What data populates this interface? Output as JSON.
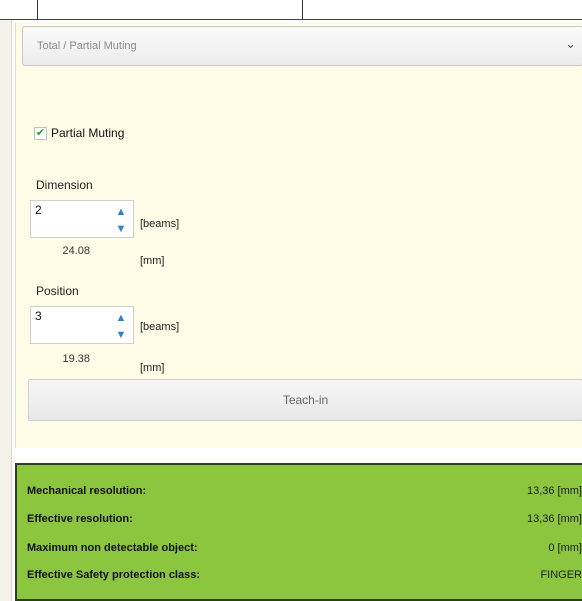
{
  "muting": {
    "dropdown_label": "Total / Partial Muting",
    "partial_muting_label": "Partial Muting",
    "partial_muting_checked": true
  },
  "dimension": {
    "title": "Dimension",
    "value": "2",
    "unit_beams": "[beams]",
    "mm_value": "24.08",
    "unit_mm": "[mm]"
  },
  "position": {
    "title": "Position",
    "value": "3",
    "unit_beams": "[beams]",
    "mm_value": "19.38",
    "unit_mm": "[mm]"
  },
  "teach_in_label": "Teach-in",
  "results": [
    {
      "label": "Mechanical resolution:",
      "value": "13,36 [mm]"
    },
    {
      "label": "Effective resolution:",
      "value": "13,36 [mm]"
    },
    {
      "label": "Maximum non detectable object:",
      "value": "0 [mm]"
    },
    {
      "label": "Effective Safety protection class:",
      "value": "FINGER"
    }
  ],
  "colors": {
    "panel_bg": "#fefbe6",
    "results_bg": "#8cc63f",
    "spinner_arrow": "#2f7fd0",
    "check_mark": "#2aa02a"
  }
}
